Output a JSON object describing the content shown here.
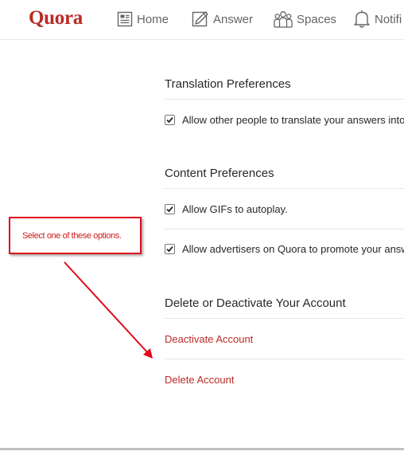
{
  "nav": {
    "logo": "Quora",
    "items": [
      {
        "label": "Home",
        "icon": "home-icon"
      },
      {
        "label": "Answer",
        "icon": "pencil-icon"
      },
      {
        "label": "Spaces",
        "icon": "people-icon"
      },
      {
        "label": "Notifi",
        "icon": "bell-icon"
      }
    ]
  },
  "translation": {
    "title": "Translation Preferences",
    "option": "Allow other people to translate your answers into",
    "checked": true
  },
  "content": {
    "title": "Content Preferences",
    "options": [
      {
        "label": "Allow GIFs to autoplay.",
        "checked": true
      },
      {
        "label": "Allow advertisers on Quora to promote your answers",
        "checked": true
      }
    ]
  },
  "account": {
    "title": "Delete or Deactivate Your Account",
    "deactivate": "Deactivate Account",
    "delete": "Delete Account"
  },
  "annotation": {
    "text": "Select one of these options."
  },
  "colors": {
    "brand": "#b92b27",
    "link": "#b92b27",
    "annotation": "#e00b1b",
    "text": "#282829",
    "muted": "#636466"
  }
}
